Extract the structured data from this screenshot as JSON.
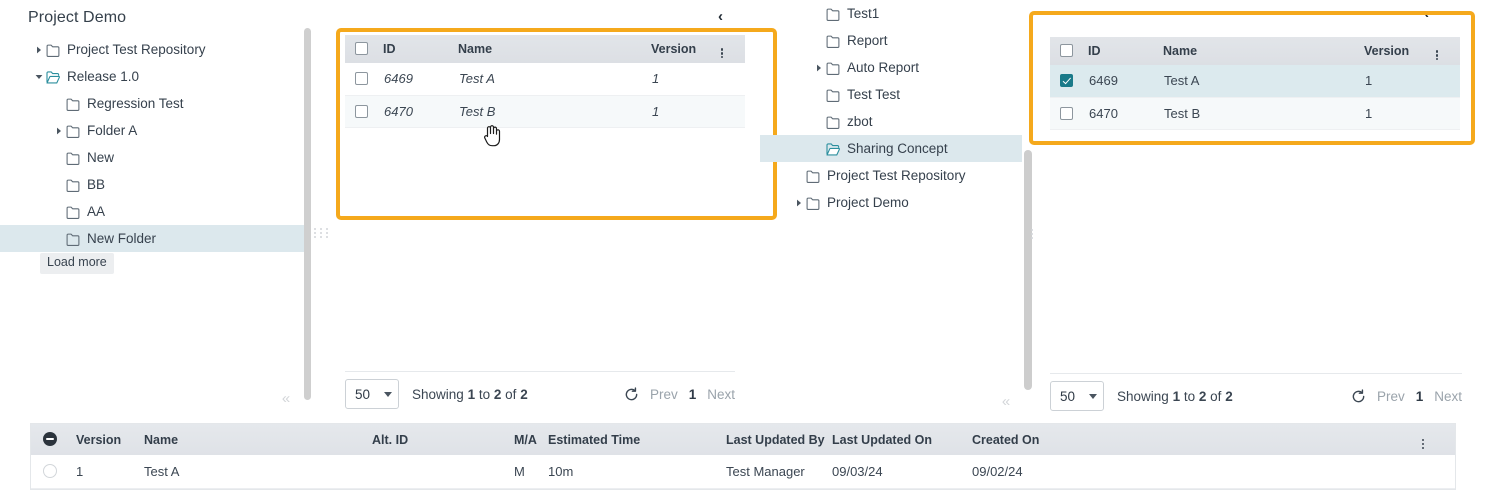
{
  "left_tree": {
    "title": "Project Demo",
    "load_more": "Load more",
    "collapse_icon": "chevron-double-left-icon",
    "items": [
      {
        "label": "Project Test Repository",
        "indent": 0,
        "caret": "right",
        "folder": "closed",
        "selected": false
      },
      {
        "label": "Release 1.0",
        "indent": 0,
        "caret": "down",
        "folder": "open",
        "selected": false
      },
      {
        "label": "Regression Test",
        "indent": 1,
        "caret": "none",
        "folder": "closed",
        "selected": false
      },
      {
        "label": "Folder A",
        "indent": 1,
        "caret": "right",
        "folder": "closed",
        "selected": false
      },
      {
        "label": "New",
        "indent": 1,
        "caret": "none",
        "folder": "closed",
        "selected": false
      },
      {
        "label": "BB",
        "indent": 1,
        "caret": "none",
        "folder": "closed",
        "selected": false
      },
      {
        "label": "AA",
        "indent": 1,
        "caret": "none",
        "folder": "closed",
        "selected": false
      },
      {
        "label": "New Folder",
        "indent": 1,
        "caret": "none",
        "folder": "closed",
        "selected": true
      }
    ]
  },
  "mid_tree": {
    "collapse_icon": "chevron-double-left-icon",
    "items": [
      {
        "label": "Test1",
        "indent": 1,
        "caret": "none",
        "folder": "closed",
        "selected": false
      },
      {
        "label": "Report",
        "indent": 1,
        "caret": "none",
        "folder": "closed",
        "selected": false
      },
      {
        "label": "Auto Report",
        "indent": 1,
        "caret": "right",
        "folder": "closed",
        "selected": false
      },
      {
        "label": "Test Test",
        "indent": 1,
        "caret": "none",
        "folder": "closed",
        "selected": false
      },
      {
        "label": "zbot",
        "indent": 1,
        "caret": "none",
        "folder": "closed",
        "selected": false
      },
      {
        "label": "Sharing Concept",
        "indent": 1,
        "caret": "none",
        "folder": "open",
        "selected": true
      },
      {
        "label": "Project Test Repository",
        "indent": 0,
        "caret": "none",
        "folder": "closed",
        "selected": false
      },
      {
        "label": "Project Demo",
        "indent": 0,
        "caret": "right",
        "folder": "closed",
        "selected": false
      }
    ]
  },
  "left_table": {
    "collapse_chevron": "‹",
    "columns": [
      "ID",
      "Name",
      "Version"
    ],
    "kebab_icon": "more-vertical-icon",
    "rows": [
      {
        "checked": false,
        "id": "6469",
        "name": "Test A",
        "version": "1"
      },
      {
        "checked": false,
        "id": "6470",
        "name": "Test B",
        "version": "1"
      }
    ],
    "pager": {
      "page_size": "50",
      "showing_prefix": "Showing",
      "showing_from": "1",
      "showing_mid": "to",
      "showing_to": "2",
      "showing_suffix": "of",
      "showing_total": "2",
      "refresh_icon": "refresh-icon",
      "prev": "Prev",
      "current_page": "1",
      "next": "Next"
    }
  },
  "right_table": {
    "collapse_chevron": "‹",
    "columns": [
      "ID",
      "Name",
      "Version"
    ],
    "kebab_icon": "more-vertical-icon",
    "rows": [
      {
        "checked": true,
        "id": "6469",
        "name": "Test A",
        "version": "1"
      },
      {
        "checked": false,
        "id": "6470",
        "name": "Test B",
        "version": "1"
      }
    ],
    "pager": {
      "page_size": "50",
      "showing_prefix": "Showing",
      "showing_from": "1",
      "showing_mid": "to",
      "showing_to": "2",
      "showing_suffix": "of",
      "showing_total": "2",
      "refresh_icon": "refresh-icon",
      "prev": "Prev",
      "current_page": "1",
      "next": "Next"
    }
  },
  "bottom_table": {
    "collapse_all_icon": "circle-minus-icon",
    "kebab_icon": "more-vertical-icon",
    "columns": [
      "Version",
      "Name",
      "Alt. ID",
      "M/A",
      "Estimated Time",
      "Last Updated By",
      "Last Updated On",
      "Created On"
    ],
    "rows": [
      {
        "version": "1",
        "name": "Test A",
        "alt_id": "",
        "ma": "M",
        "estimated_time": "10m",
        "last_updated_by": "Test Manager",
        "last_updated_on": "09/03/24",
        "created_on": "09/02/24"
      }
    ]
  },
  "colors": {
    "highlight_border": "#f5a91c",
    "selection_teal": "#1a7a89",
    "tree_selected_bg": "#dce8ed",
    "header_bg": "#e0e3e8"
  }
}
